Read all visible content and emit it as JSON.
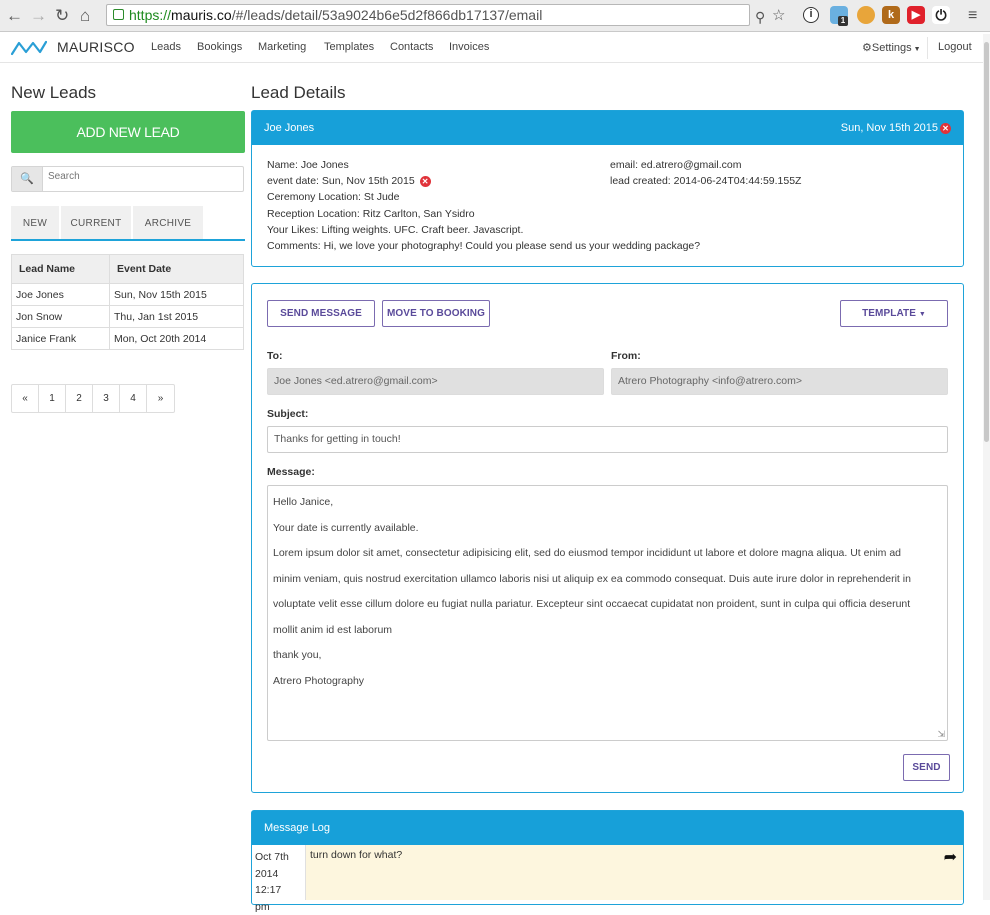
{
  "browser": {
    "url_https": "https://",
    "url_host": "mauris.co",
    "url_path": "/#/leads/detail/53a9024b6e5d2f866db17137/email",
    "ext_badge": "1"
  },
  "nav": {
    "brand": "MAURISCO",
    "links": [
      "Leads",
      "Bookings",
      "Marketing",
      "Templates",
      "Contacts",
      "Invoices"
    ],
    "settings": "Settings",
    "logout": "Logout"
  },
  "left": {
    "title": "New Leads",
    "add_button": "ADD NEW LEAD",
    "search_placeholder": "Search",
    "tabs": [
      "NEW",
      "CURRENT",
      "ARCHIVE"
    ],
    "table_headers": [
      "Lead Name",
      "Event Date"
    ],
    "rows": [
      [
        "Joe Jones",
        "Sun, Nov 15th 2015"
      ],
      [
        "Jon Snow",
        "Thu, Jan 1st 2015"
      ],
      [
        "Janice Frank",
        "Mon, Oct 20th 2014"
      ]
    ],
    "pager": [
      "«",
      "1",
      "2",
      "3",
      "4",
      "»"
    ]
  },
  "details": {
    "title": "Lead Details",
    "head_name": "Joe Jones",
    "head_date": "Sun, Nov 15th 2015",
    "name": "Name: Joe Jones",
    "event_date": "event date: Sun, Nov 15th 2015",
    "ceremony": "Ceremony Location: St Jude",
    "reception": "Reception Location: Ritz Carlton, San Ysidro",
    "likes": "Your Likes: Lifting weights. UFC. Craft beer. Javascript.",
    "comments": "Comments: Hi, we love your photography! Could you please send us your wedding package?",
    "email": "email: ed.atrero@gmail.com",
    "created": "lead created: 2014-06-24T04:44:59.155Z"
  },
  "compose": {
    "send_message": "SEND MESSAGE",
    "move_to_booking": "MOVE TO BOOKING",
    "template": "TEMPLATE",
    "to_label": "To:",
    "to_value": "Joe Jones <ed.atrero@gmail.com>",
    "from_label": "From:",
    "from_value": "Atrero Photography <info@atrero.com>",
    "subject_label": "Subject:",
    "subject_value": "Thanks for getting in touch!",
    "message_label": "Message:",
    "greeting": "Hello Janice,",
    "line2": "Your date is currently available.",
    "lorem1": "Lorem ipsum dolor sit amet, consectetur adipisicing elit, sed do eiusmod tempor incididunt ut labore et dolore magna aliqua. Ut enim ad",
    "lorem2": "minim veniam, quis nostrud exercitation ullamco laboris nisi ut aliquip ex ea commodo consequat. Duis aute irure dolor in reprehenderit in",
    "lorem3": "voluptate velit esse cillum dolore eu fugiat nulla pariatur. Excepteur sint occaecat cupidatat non proident, sunt in culpa qui officia deserunt",
    "lorem4": "mollit anim id est laborum",
    "signoff": "thank you,",
    "signature": "Atrero Photography",
    "send": "SEND"
  },
  "log": {
    "title": "Message Log",
    "date_line1": "Oct 7th",
    "date_line2": "2014 12:17",
    "date_line3": "pm",
    "text": "turn down for what?"
  }
}
